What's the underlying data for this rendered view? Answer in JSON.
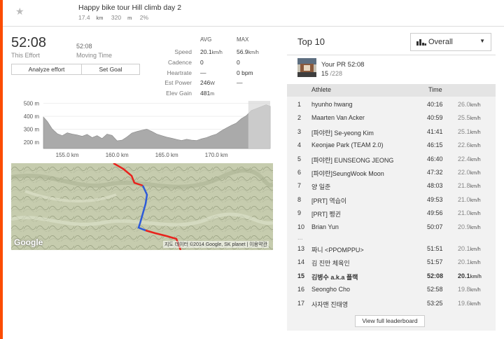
{
  "colors": {
    "accent": "#fc4c02",
    "route_red": "#e8231d",
    "route_blue": "#2e5bd8"
  },
  "segment": {
    "title": "Happy bike tour Hill climb day 2",
    "distance": "17.4",
    "distance_unit": "km",
    "elevation": "320",
    "elevation_unit": "m",
    "grade": "2%"
  },
  "effort": {
    "time": "52:08",
    "time_label": "This Effort",
    "moving_time": "52:08",
    "moving_label": "Moving Time",
    "analyze_label": "Analyze effort",
    "goal_label": "Set Goal"
  },
  "stats": {
    "avg_header": "AVG",
    "max_header": "MAX",
    "rows": [
      {
        "label": "Speed",
        "avg": "20.1",
        "avg_unit": "km/h",
        "max": "56.9",
        "max_unit": "km/h"
      },
      {
        "label": "Cadence",
        "avg": "0",
        "avg_unit": "",
        "max": "0",
        "max_unit": ""
      },
      {
        "label": "Heartrate",
        "avg": "—",
        "avg_unit": "",
        "max": "0",
        "max_unit": " bpm"
      },
      {
        "label": "Est Power",
        "avg": "246",
        "avg_unit": "W",
        "max": "—",
        "max_unit": ""
      },
      {
        "label": "Elev Gain",
        "avg": "481",
        "avg_unit": "m",
        "max": "",
        "max_unit": ""
      }
    ]
  },
  "chart_data": {
    "type": "area",
    "y_ticks": [
      "500 m",
      "400 m",
      "300 m",
      "200 m"
    ],
    "x_ticks": [
      "155.0 km",
      "160.0 km",
      "165.0 km",
      "170.0 km"
    ],
    "x_tick_values": [
      155,
      160,
      165,
      170
    ],
    "y_tick_values": [
      500,
      400,
      300,
      200
    ],
    "xlim": [
      152.6,
      175.4
    ],
    "ylim": [
      150,
      520
    ],
    "profile_x": [
      152.6,
      153,
      153.5,
      154,
      154.5,
      155,
      155.5,
      156,
      156.5,
      157,
      157.5,
      158,
      158.5,
      159,
      159.5,
      160,
      160.5,
      161,
      161.5,
      162,
      162.5,
      163,
      163.5,
      164,
      164.5,
      165,
      165.5,
      166,
      166.5,
      167,
      167.5,
      168,
      168.5,
      169,
      169.5,
      170,
      170.5,
      171,
      171.5,
      172,
      172.5,
      173,
      173.5,
      174,
      174.5,
      175,
      175.4
    ],
    "profile_y": [
      395,
      360,
      300,
      265,
      250,
      272,
      262,
      255,
      245,
      260,
      235,
      250,
      228,
      262,
      252,
      210,
      215,
      240,
      270,
      282,
      292,
      300,
      282,
      262,
      250,
      238,
      230,
      220,
      212,
      222,
      215,
      212,
      225,
      235,
      250,
      262,
      288,
      310,
      330,
      348,
      382,
      405,
      445,
      460,
      475,
      490,
      478
    ],
    "highlight_x": [
      173.2,
      175.4
    ]
  },
  "map": {
    "google": "Google",
    "copyright": "지도 데이터 ©2014 Google, SK planet | 이용약관"
  },
  "leaderboard": {
    "title": "Top 10",
    "filter": "Overall",
    "pr_label": "Your PR 52:08",
    "pr_rank": "15",
    "pr_total": "/228",
    "col_athlete": "Athlete",
    "col_time": "Time",
    "ellipsis": "...",
    "rows": [
      {
        "rank": "1",
        "name": "hyunho hwang",
        "time": "40:16",
        "speed": "26.0",
        "unit": "km/h",
        "hl": false
      },
      {
        "rank": "2",
        "name": "Maarten Van Acker",
        "time": "40:59",
        "speed": "25.5",
        "unit": "km/h",
        "hl": false
      },
      {
        "rank": "3",
        "name": "[파야란] Se-yeong Kim",
        "time": "41:41",
        "speed": "25.1",
        "unit": "km/h",
        "hl": false
      },
      {
        "rank": "4",
        "name": "Keonjae Park (TEAM 2.0)",
        "time": "46:15",
        "speed": "22.6",
        "unit": "km/h",
        "hl": false
      },
      {
        "rank": "5",
        "name": "[파야란] EUNSEONG JEONG",
        "time": "46:40",
        "speed": "22.4",
        "unit": "km/h",
        "hl": false
      },
      {
        "rank": "6",
        "name": "[파야란]SeungWook Moon",
        "time": "47:32",
        "speed": "22.0",
        "unit": "km/h",
        "hl": false
      },
      {
        "rank": "7",
        "name": "양 일준",
        "time": "48:03",
        "speed": "21.8",
        "unit": "km/h",
        "hl": false
      },
      {
        "rank": "8",
        "name": "[PRT] 역습이",
        "time": "49:53",
        "speed": "21.0",
        "unit": "km/h",
        "hl": false
      },
      {
        "rank": "9",
        "name": "[PRT] 펭귄",
        "time": "49:56",
        "speed": "21.0",
        "unit": "km/h",
        "hl": false
      },
      {
        "rank": "10",
        "name": "Brian Yun",
        "time": "50:07",
        "speed": "20.9",
        "unit": "km/h",
        "hl": false
      },
      {
        "rank": "13",
        "name": "짜니 <PPOMPPU>",
        "time": "51:51",
        "speed": "20.1",
        "unit": "km/h",
        "hl": false
      },
      {
        "rank": "14",
        "name": "김 진만 체육인",
        "time": "51:57",
        "speed": "20.1",
        "unit": "km/h",
        "hl": false
      },
      {
        "rank": "15",
        "name": "김병수 a.k.a 플랙",
        "time": "52:08",
        "speed": "20.1",
        "unit": "km/h",
        "hl": true
      },
      {
        "rank": "16",
        "name": "Seongho Cho",
        "time": "52:58",
        "speed": "19.8",
        "unit": "km/h",
        "hl": false
      },
      {
        "rank": "17",
        "name": "사자맨 진태영",
        "time": "53:25",
        "speed": "19.6",
        "unit": "km/h",
        "hl": false
      }
    ],
    "full_label": "View full leaderboard"
  }
}
